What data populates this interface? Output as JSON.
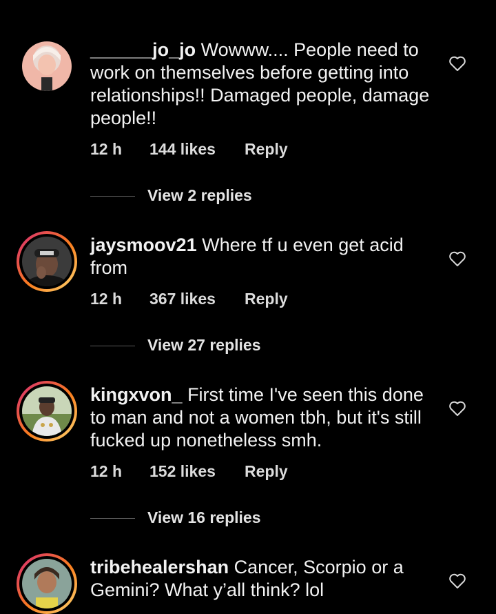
{
  "comments": [
    {
      "username": "______jo_jo",
      "text": "Wowww.... People need to work on themselves before getting into relationships!! Damaged people, damage people!!",
      "time": "12 h",
      "likes": "144 likes",
      "reply": "Reply",
      "view_replies": "View 2 replies",
      "story_ring": false
    },
    {
      "username": "jaysmoov21",
      "text": "Where tf u even get acid from",
      "time": "12 h",
      "likes": "367 likes",
      "reply": "Reply",
      "view_replies": "View 27 replies",
      "story_ring": true
    },
    {
      "username": "kingxvon_",
      "text": "First time I've seen this done to man and not a women tbh, but it's still fucked up nonetheless smh.",
      "time": "12 h",
      "likes": "152 likes",
      "reply": "Reply",
      "view_replies": "View 16 replies",
      "story_ring": true
    },
    {
      "username": "tribehealershan",
      "text": "Cancer, Scorpio or a Gemini? What y’all think? lol",
      "story_ring": true
    }
  ],
  "icons": {
    "like": "heart-outline-icon"
  },
  "colors": {
    "background": "#000000",
    "text": "#f2f2f2",
    "ring_start": "#d62976",
    "ring_end": "#feda75"
  }
}
